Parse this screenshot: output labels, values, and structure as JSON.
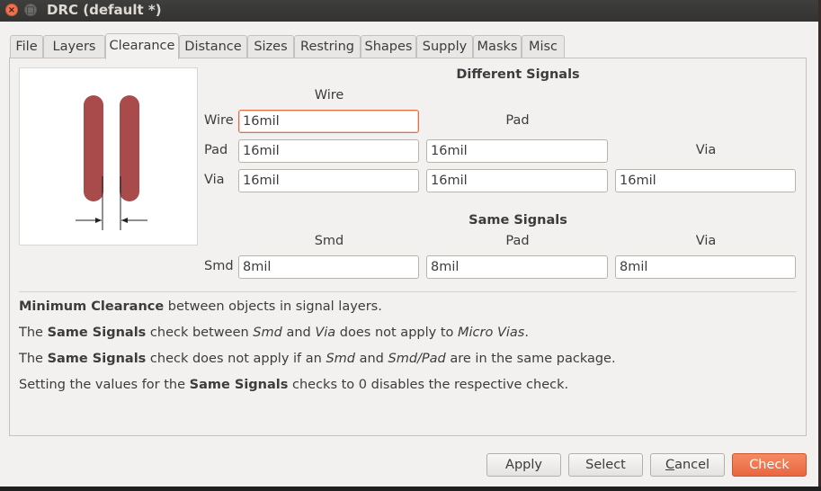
{
  "window": {
    "title": "DRC (default *)",
    "close_glyph": "×",
    "max_glyph": "□"
  },
  "tabs": [
    {
      "label": "File"
    },
    {
      "label": "Layers"
    },
    {
      "label": "Clearance",
      "active": true
    },
    {
      "label": "Distance"
    },
    {
      "label": "Sizes"
    },
    {
      "label": "Restring"
    },
    {
      "label": "Shapes"
    },
    {
      "label": "Supply"
    },
    {
      "label": "Masks"
    },
    {
      "label": "Misc"
    }
  ],
  "diagram": {
    "icon": "two-wires-clearance-diagram",
    "wire_color": "#a94b4b"
  },
  "different_signals": {
    "heading": "Different Signals",
    "col_wire": "Wire",
    "col_pad": "Pad",
    "col_via": "Via",
    "row_wire": "Wire",
    "row_pad": "Pad",
    "row_via": "Via",
    "wire_wire": "16mil",
    "pad_wire": "16mil",
    "pad_pad": "16mil",
    "via_wire": "16mil",
    "via_pad": "16mil",
    "via_via": "16mil"
  },
  "same_signals": {
    "heading": "Same Signals",
    "col_smd": "Smd",
    "col_pad": "Pad",
    "col_via": "Via",
    "row_smd": "Smd",
    "smd_smd": "8mil",
    "smd_pad": "8mil",
    "smd_via": "8mil"
  },
  "info": {
    "line1_b": "Minimum Clearance",
    "line1_t": " between objects in signal layers.",
    "line2_a": "The ",
    "line2_b": "Same Signals",
    "line2_c": " check between ",
    "line2_i1": "Smd",
    "line2_d": " and ",
    "line2_i2": "Via",
    "line2_e": " does not apply to ",
    "line2_i3": "Micro Vias",
    "line2_f": ".",
    "line3_a": "The ",
    "line3_b": "Same Signals",
    "line3_c": " check does not apply if an ",
    "line3_i1": "Smd",
    "line3_d": " and ",
    "line3_i2": "Smd/Pad",
    "line3_e": " are in the same package.",
    "line4_a": "Setting the values for the ",
    "line4_b": "Same Signals",
    "line4_c": " checks to 0 disables the respective check."
  },
  "buttons": {
    "apply": "Apply",
    "select": "Select",
    "cancel_first": "C",
    "cancel_rest": "ancel",
    "check": "Check"
  },
  "colors": {
    "accent": "#e9673f",
    "focus_border": "#e26f43"
  }
}
